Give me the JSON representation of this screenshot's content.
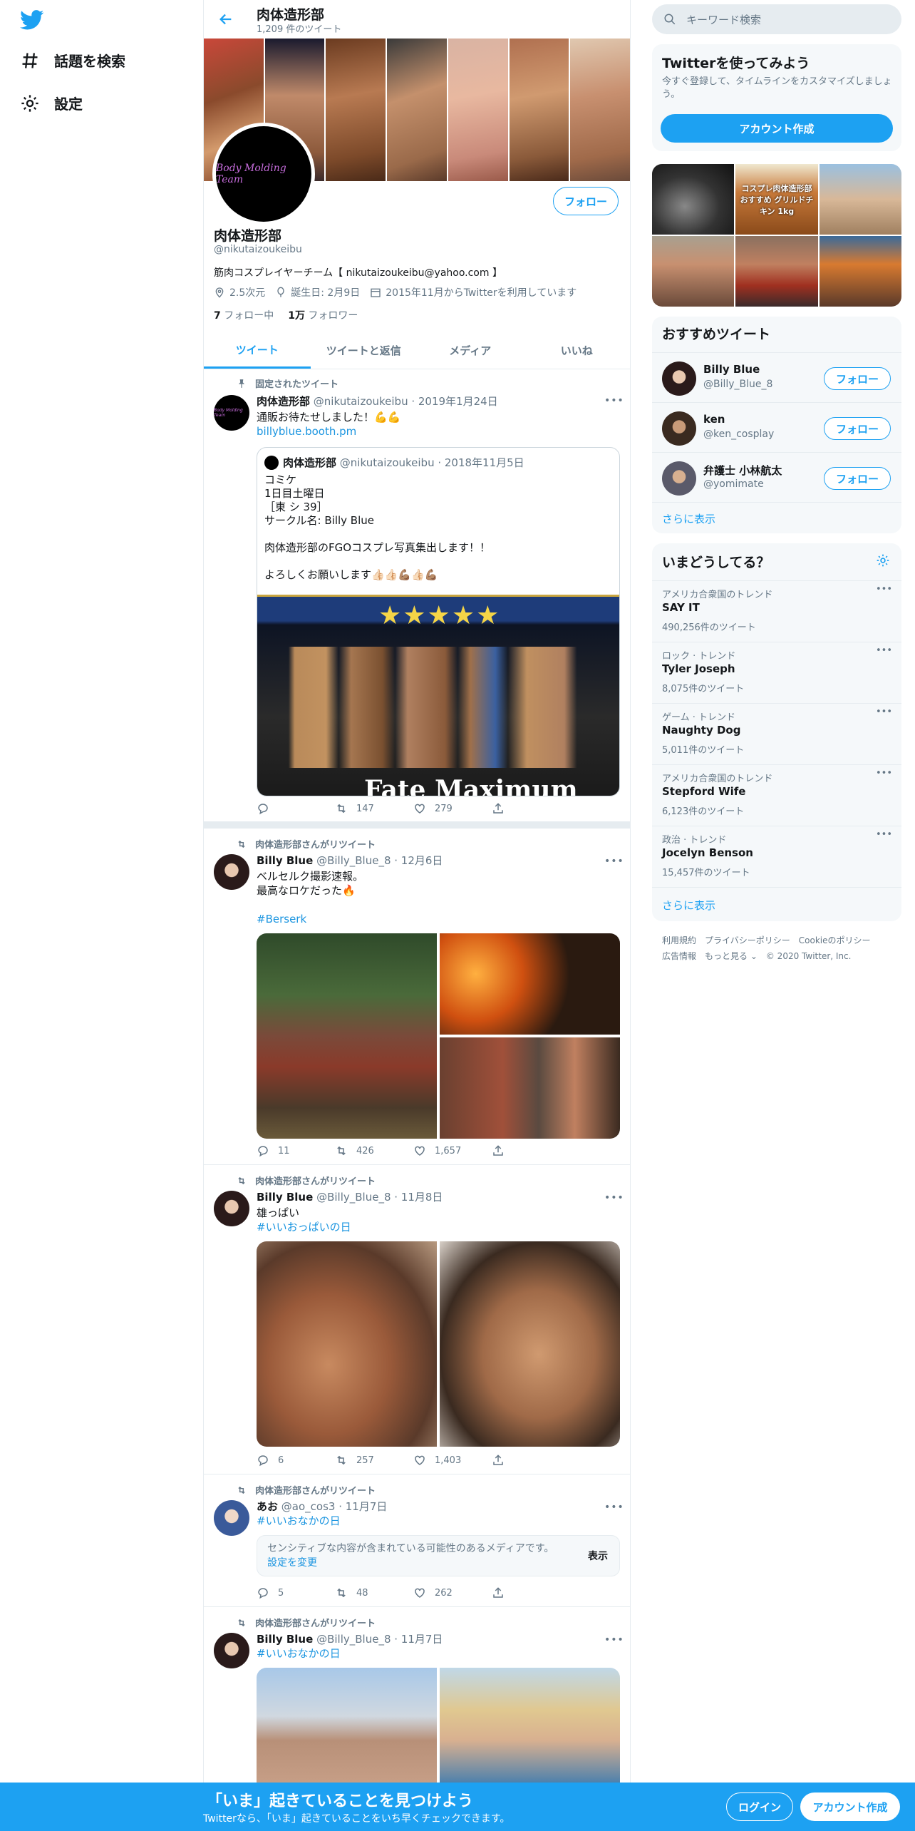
{
  "nav": {
    "search_label": "話題を検索",
    "settings_label": "設定"
  },
  "header": {
    "title": "肉体造形部",
    "tweet_count": "1,209 件のツイート"
  },
  "profile": {
    "avatar_text": "Body Molding Team",
    "follow_label": "フォロー",
    "name": "肉体造形部",
    "handle": "@nikutaizoukeibu",
    "bio": "筋肉コスプレイヤーチーム【 nikutaizoukeibu@yahoo.com 】",
    "location": "2.5次元",
    "birthday": "誕生日: 2月9日",
    "joined": "2015年11月からTwitterを利用しています",
    "following_count": "7",
    "following_label": "フォロー中",
    "followers_count": "1万",
    "followers_label": "フォロワー"
  },
  "tabs": [
    "ツイート",
    "ツイートと返信",
    "メディア",
    "いいね"
  ],
  "tweets": [
    {
      "context": "固定されたツイート",
      "name": "肉体造形部",
      "meta": "@nikutaizoukeibu · 2019年1月24日",
      "text": "通販お待たせしました！💪💪",
      "link": "billyblue.booth.pm",
      "quote": {
        "name": "肉体造形部",
        "meta": "@nikutaizoukeibu · 2018年11月5日",
        "lines": [
          "コミケ",
          "1日目土曜日",
          "［東 シ 39］",
          "サークル名: Billy Blue",
          "",
          "肉体造形部のFGOコスプレ写真集出します！！",
          "",
          "よろしくお願いします👍🏻👍🏻💪🏽👍🏻💪🏽"
        ],
        "image_caption": "Fate Maximum"
      },
      "replies": "",
      "retweets": "147",
      "likes": "279"
    },
    {
      "context": "肉体造形部さんがリツイート",
      "name": "Billy Blue",
      "meta": "@Billy_Blue_8 · 12月6日",
      "lines": [
        "ベルセルク撮影速報。",
        "最高なロケだった🔥"
      ],
      "hashtag": "#Berserk",
      "replies": "11",
      "retweets": "426",
      "likes": "1,657"
    },
    {
      "context": "肉体造形部さんがリツイート",
      "name": "Billy Blue",
      "meta": "@Billy_Blue_8 · 11月8日",
      "lines": [
        "雄っぱい"
      ],
      "hashtag": "#いいおっぱいの日",
      "replies": "6",
      "retweets": "257",
      "likes": "1,403"
    },
    {
      "context": "肉体造形部さんがリツイート",
      "name": "あお",
      "meta": "@ao_cos3 · 11月7日",
      "hashtag": "#いいおなかの日",
      "sensitive": "センシティブな内容が含まれている可能性のあるメディアです。",
      "sensitive_link": "設定を変更",
      "sensitive_show": "表示",
      "replies": "5",
      "retweets": "48",
      "likes": "262"
    },
    {
      "context": "肉体造形部さんがリツイート",
      "name": "Billy Blue",
      "meta": "@Billy_Blue_8 · 11月7日",
      "hashtag": "#いいおなかの日"
    }
  ],
  "right": {
    "search_placeholder": "キーワード検索",
    "signup_title": "Twitterを使ってみよう",
    "signup_sub": "今すぐ登録して、タイムラインをカスタマイズしましょう。",
    "signup_button": "アカウント作成",
    "media_caption": "コスプレ肉体造形部おすすめ グリルドチキン 1kg",
    "suggest_title": "おすすめツイート",
    "suggestions": [
      {
        "name": "Billy Blue",
        "handle": "@Billy_Blue_8",
        "btn": "フォロー"
      },
      {
        "name": "ken",
        "handle": "@ken_cosplay",
        "btn": "フォロー"
      },
      {
        "name": "弁護士 小林航太",
        "handle": "@yomimate",
        "btn": "フォロー"
      }
    ],
    "show_more": "さらに表示",
    "trends_title": "いまどうしてる？",
    "trends": [
      {
        "cat": "アメリカ合衆国のトレンド",
        "name": "SAY IT",
        "count": "490,256件のツイート"
      },
      {
        "cat": "ロック · トレンド",
        "name": "Tyler Joseph",
        "count": "8,075件のツイート"
      },
      {
        "cat": "ゲーム · トレンド",
        "name": "Naughty Dog",
        "count": "5,011件のツイート"
      },
      {
        "cat": "アメリカ合衆国のトレンド",
        "name": "Stepford Wife",
        "count": "6,123件のツイート"
      },
      {
        "cat": "政治 · トレンド",
        "name": "Jocelyn Benson",
        "count": "15,457件のツイート"
      }
    ],
    "trends_more": "さらに表示",
    "footer_line1": "利用規約　プライバシーポリシー　Cookieのポリシー",
    "footer_line2": "広告情報　もっと見る ⌄　© 2020 Twitter, Inc."
  },
  "bottom": {
    "title": "「いま」起きていることを見つけよう",
    "sub": "Twitterなら、「いま」起きていることをいち早くチェックできます。",
    "login": "ログイン",
    "signup": "アカウント作成"
  },
  "colors": {
    "accent": "#1da1f2",
    "text": "#14171a",
    "secondary": "#657786",
    "panel": "#f5f8fa"
  }
}
